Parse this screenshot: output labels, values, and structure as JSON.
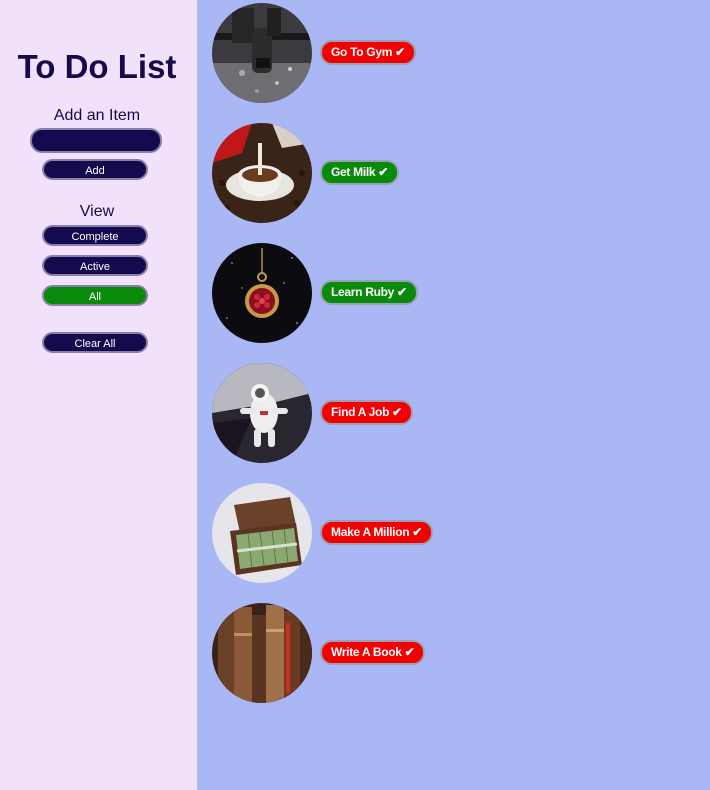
{
  "sidebar": {
    "title": "To Do List",
    "add_label": "Add an Item",
    "input_value": "",
    "add_button": "Add",
    "view_label": "View",
    "view_buttons": {
      "complete": "Complete",
      "active": "Active",
      "all": "All"
    },
    "clear_button": "Clear All",
    "colors": {
      "background": "#f2e1fb",
      "button": "#140a4e",
      "selected_button": "#0a8a0a",
      "text": "#160a4a"
    }
  },
  "main": {
    "background": "#a9b7f5",
    "todos": [
      {
        "label": "Go To Gym",
        "check": "✔",
        "status": "active",
        "color": "#f50000",
        "image": "gym-photo"
      },
      {
        "label": "Get Milk",
        "check": "✔",
        "status": "complete",
        "color": "#0a8a0a",
        "image": "coffee-photo"
      },
      {
        "label": "Learn Ruby",
        "check": "✔",
        "status": "complete",
        "color": "#0a8a0a",
        "image": "ruby-pendant-photo"
      },
      {
        "label": "Find A Job",
        "check": "✔",
        "status": "active",
        "color": "#f50000",
        "image": "astronaut-photo"
      },
      {
        "label": "Make A Million",
        "check": "✔",
        "status": "active",
        "color": "#f50000",
        "image": "money-briefcase-photo"
      },
      {
        "label": "Write A Book",
        "check": "✔",
        "status": "active",
        "color": "#f50000",
        "image": "old-books-photo"
      }
    ]
  }
}
